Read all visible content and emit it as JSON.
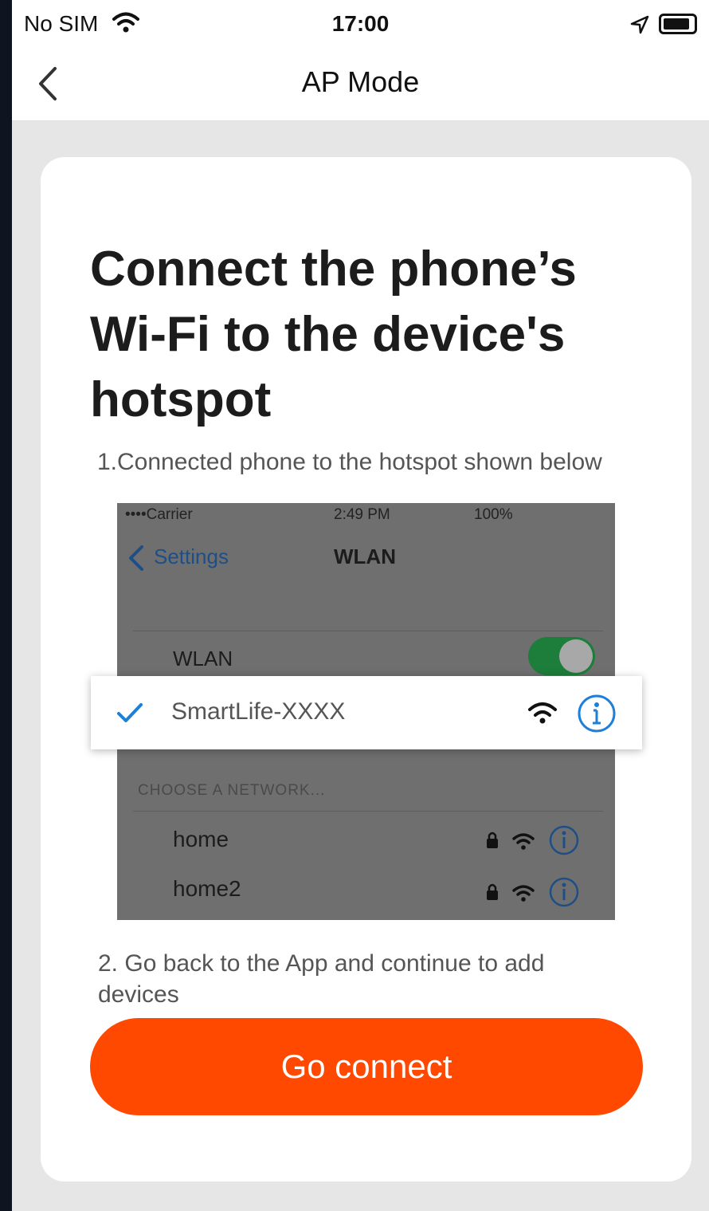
{
  "status_bar": {
    "carrier": "No SIM",
    "time": "17:00"
  },
  "nav": {
    "title": "AP Mode"
  },
  "content": {
    "heading": "Connect the phone’s Wi-Fi to the device's hotspot",
    "step1": "1.Connected phone to the hotspot shown below",
    "step2": "2. Go back to the App and continue to add devices"
  },
  "illustration": {
    "status_carrier": "••••Carrier ⁠",
    "status_time": "2:49 PM",
    "status_battery": "100%",
    "back_label": "Settings",
    "title": "WLAN",
    "wlan_label": "WLAN",
    "selected_network": "SmartLife-XXXX",
    "choose_label": "CHOOSE A NETWORK...",
    "networks": [
      "home",
      "home2"
    ]
  },
  "actions": {
    "go_connect": "Go connect"
  },
  "colors": {
    "accent": "#ff4800",
    "check": "#1e7fd8"
  }
}
